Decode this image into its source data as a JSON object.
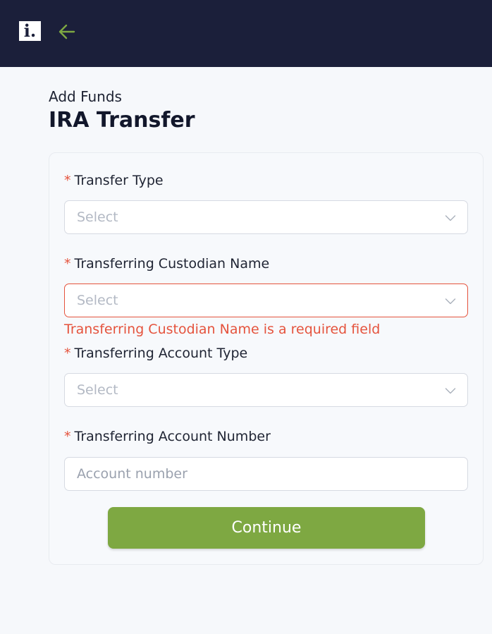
{
  "header": {
    "logo_text": "i.",
    "back_icon": "arrow-left-icon",
    "accent_color": "#7ea842",
    "background_color": "#1b1f3a"
  },
  "page": {
    "subtitle": "Add Funds",
    "title": "IRA Transfer"
  },
  "form": {
    "required_mark": "*",
    "fields": [
      {
        "label": "Transfer Type",
        "placeholder": "Select",
        "type": "select"
      },
      {
        "label": "Transferring Custodian Name",
        "placeholder": "Select",
        "type": "select",
        "error": "Transferring Custodian Name is a required field"
      },
      {
        "label": "Transferring Account Type",
        "placeholder": "Select",
        "type": "select"
      },
      {
        "label": "Transferring Account Number",
        "placeholder": "Account number",
        "type": "text"
      }
    ],
    "submit_label": "Continue",
    "error_color": "#e5533d"
  }
}
